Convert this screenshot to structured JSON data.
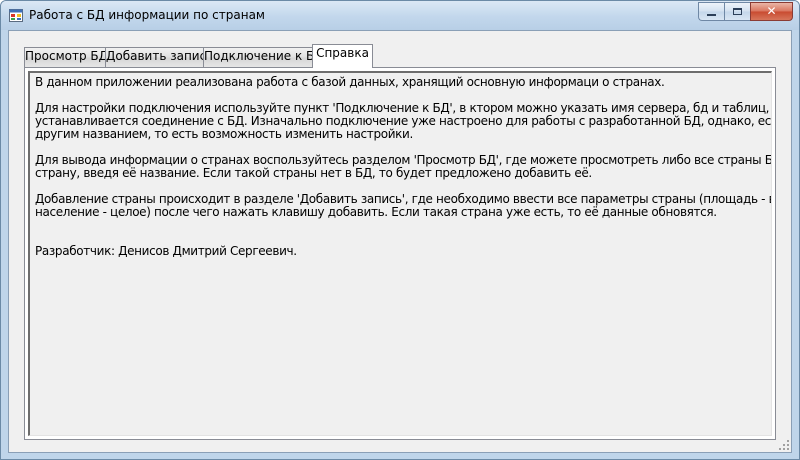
{
  "window": {
    "title": "Работа с БД информации по странам",
    "caption_buttons": {
      "minimize_icon": "minimize-icon",
      "maximize_icon": "maximize-icon",
      "close_icon": "close-icon",
      "close_glyph": "✕"
    }
  },
  "tabs": [
    {
      "label": "Просмотр БД",
      "active": false
    },
    {
      "label": "Добавить запись",
      "active": false
    },
    {
      "label": "Подключение к БД",
      "active": false
    },
    {
      "label": "Справка",
      "active": true
    }
  ],
  "help": {
    "paragraphs": [
      [
        "В данном приложении реализована работа с базой данных, хранящий основную информаци о странах."
      ],
      [
        "Для настройки подключения используйте пункт 'Подключение к БД', в ктором можно указать имя сервера, бд и таблиц, а также просмотреть,",
        "устанавливается соединение с БД. Изначально подключение уже настроено для работы с разработанной БД, однако, если используется БД с",
        "другим названием, то есть возможность изменить настройки."
      ],
      [
        "Для вывода информации о странах воспользуйтесь разделом 'Просмотр БД', где можете просмотреть либо все страны БД, либо конкретную",
        "страну, введя её название. Если такой страны нет в БД, то будет предложено добавить её."
      ],
      [
        "Добавление страны происходит в разделе 'Добавить запись', где необходимо ввести все параметры страны (площадь - вещественной число,",
        "население - целое) после чего нажать клавишу добавить. Если такая страна уже есть, то её данные обновятся."
      ]
    ],
    "developer": "Разработчик: Денисов Дмитрий Сергеевич."
  },
  "colors": {
    "titlebar": "#c2d7ec",
    "close_button": "#c84a30",
    "client_background": "#f0f0f0"
  }
}
